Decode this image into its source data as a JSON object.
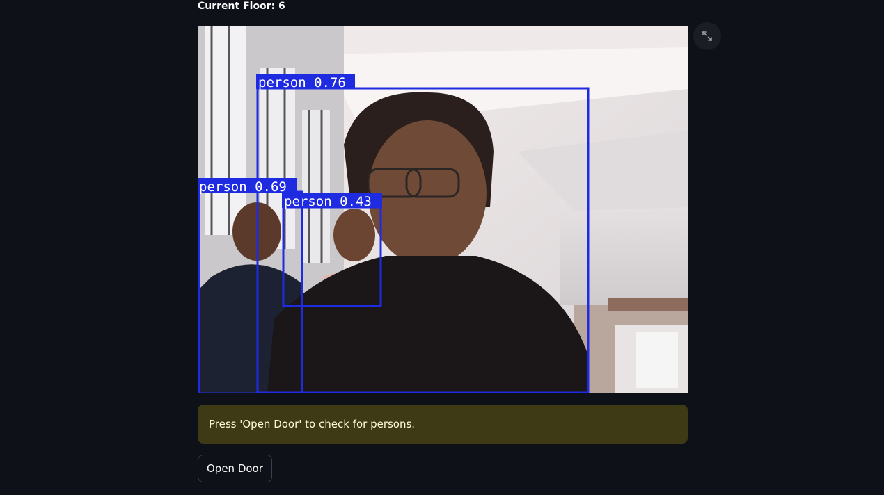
{
  "header": {
    "floor_label": "Current Floor: 6"
  },
  "camera_feed": {
    "detections": [
      {
        "label": "person 0.76",
        "class": "person",
        "confidence": 0.76
      },
      {
        "label": "person 0.69",
        "class": "person",
        "confidence": 0.69
      },
      {
        "label": "person 0.43",
        "class": "person",
        "confidence": 0.43
      }
    ],
    "box_color": "#1f2be0",
    "fullscreen_icon": "expand-icon"
  },
  "alert": {
    "message": "Press 'Open Door' to check for persons.",
    "background": "#3e3a16",
    "text_color": "#fefcd4"
  },
  "actions": {
    "open_door_label": "Open Door"
  }
}
